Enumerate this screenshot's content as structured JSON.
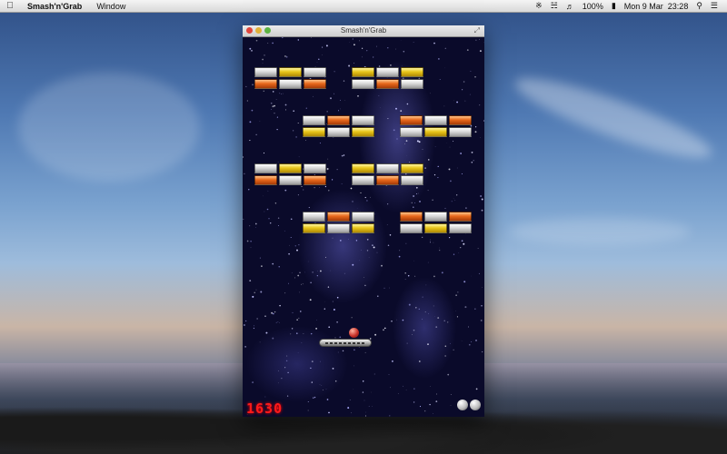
{
  "menubar": {
    "app_name": "Smash'n'Grab",
    "menus": [
      "Window"
    ],
    "battery": "100%",
    "clock": "Mon 9 Mar  23:28"
  },
  "window": {
    "title": "Smash'n'Grab"
  },
  "game": {
    "score": "1630",
    "lives_remaining": 2,
    "brick_rows": [
      [
        "white",
        "gold",
        "white",
        "gold",
        "white",
        "gold"
      ],
      [
        "orange",
        "white",
        "orange",
        "white",
        "orange",
        "white"
      ],
      [
        "white",
        "orange",
        "white",
        "orange",
        "white",
        "orange"
      ],
      [
        "gold",
        "white",
        "gold",
        "white",
        "gold",
        "white"
      ],
      [
        "white",
        "gold",
        "white",
        "gold",
        "white",
        "gold"
      ],
      [
        "orange",
        "white",
        "orange",
        "white",
        "orange",
        "white"
      ],
      [
        "white",
        "orange",
        "white",
        "orange",
        "white",
        "orange"
      ],
      [
        "gold",
        "white",
        "gold",
        "white",
        "gold",
        "white"
      ]
    ]
  }
}
